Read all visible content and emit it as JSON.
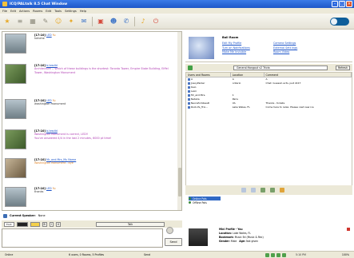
{
  "window": {
    "title": "ICQ/PALtalk 8.5 Chat Window",
    "colors": {
      "titlebar": "#2a67d8",
      "menubar": "#ece9d8",
      "link": "#1b53c8"
    }
  },
  "menu": [
    "File",
    "Edit",
    "Actions",
    "Rooms",
    "Edit",
    "Tools",
    "Settings",
    "Help"
  ],
  "toolbar": {
    "icons": [
      "star-icon",
      "list-icon",
      "grid-icon",
      "pen-icon",
      "smiley-icon",
      "bookmark-icon",
      "chat-icon",
      "folder-icon",
      "people-icon",
      "phone-icon",
      "bell-icon",
      "power-icon"
    ]
  },
  "chat": {
    "messages": [
      {
        "time": "[17:10]",
        "nick": "LED",
        "tail": "%:",
        "text": "hehehe",
        "style": "normal"
      },
      {
        "time": "[17:10]",
        "nick": "b-tesdld",
        "tail": "",
        "text": "Architecture -- Which of these buildings is the shortest: Toronto Tower, Empire State Building, Eiffel Tower, Washington Monument",
        "style": "purple"
      },
      {
        "time": "[17:10]",
        "nick": "LED",
        "tail": "%:",
        "text": "washington monument",
        "style": "normal"
      },
      {
        "time": "[17:10]",
        "nick": "b-tesdld",
        "tail": "",
        "text": "Washington Monument is correct, LED!!",
        "extra": "You've answered 4/4 in the last 2 minutes, 6000 pt time!",
        "style": "purple"
      },
      {
        "time": "[17:10]",
        "nick": "Mr_and.Mrs_My Name",
        "tail": "",
        "text": "Washington Monument - bye",
        "style": "orange"
      },
      {
        "time": "[17:10]",
        "nick": "LED",
        "tail": "%:",
        "text": "thanks",
        "style": "normal"
      }
    ],
    "speaker": {
      "label": "Current Speaker:",
      "value": "None"
    },
    "format": {
      "font": "Font",
      "size": "10",
      "bold": "B",
      "italic": "I",
      "underline": "U",
      "talk": "Talk"
    },
    "send_label": "Send"
  },
  "room": {
    "name": "Ball Room",
    "links": [
      "Edit My Profile",
      "Camera Settings",
      "Turn on Notifications",
      "External Sett Ings",
      "Make Me Invisible",
      "Room Video"
    ],
    "selector": "General:Hangout v2 Trivia",
    "refresh_label": "Refresh"
  },
  "users": {
    "columns": [
      "Users and Rooms",
      "Location",
      "Comment"
    ],
    "rows": [
      {
        "name": "A",
        "location": "A",
        "comment": "A"
      },
      {
        "name": "JosoyParker",
        "location": "ontario",
        "comment": "Chet: Guessin acts, just 2k17"
      },
      {
        "name": "Kaio",
        "location": "",
        "comment": ""
      },
      {
        "name": "Lexii",
        "location": "",
        "comment": ""
      },
      {
        "name": "Mr_and.Mrs.",
        "location": "1",
        "comment": ""
      },
      {
        "name": "Natalia",
        "location": "Paris",
        "comment": ""
      },
      {
        "name": "NeonZombiesD",
        "location": "VA",
        "comment": "Thanks - tickets"
      },
      {
        "name": "Rock.Ps_Trio...",
        "location": "Lake Wales, FL",
        "comment": "Come here to relax. Please cast new ice"
      }
    ],
    "list": [
      {
        "label": "Online Pals",
        "selected": true
      },
      {
        "label": "Offline Pals",
        "selected": false
      }
    ]
  },
  "profile": {
    "title": "Mini Profile - You",
    "location_label": "Location:",
    "location": "Lake Wales, FL",
    "bookmark_label": "Bookmark:",
    "bookmark": "Music Ed (Music & Rec)",
    "gender_label": "Gender:",
    "gender": "Male",
    "age_label": "Age:",
    "age": "Not given"
  },
  "status": {
    "left": "Online",
    "users": "6 users, 0 Rooms, 5 Profiles",
    "center": "Send",
    "time_label": "5:10 PM",
    "zoom": "100%"
  }
}
